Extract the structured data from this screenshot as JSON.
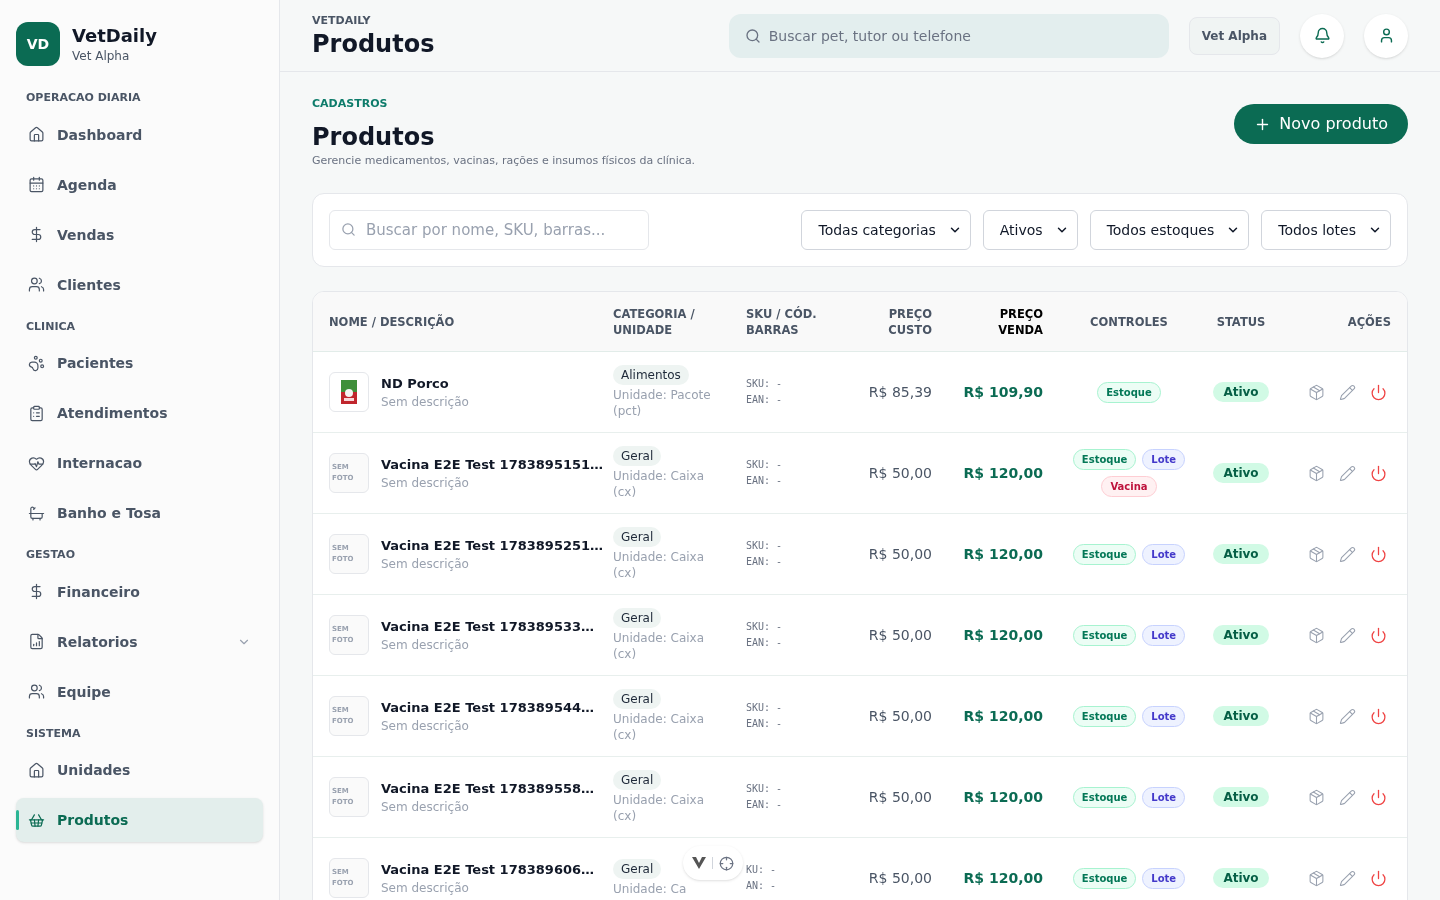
{
  "brand": {
    "logo": "VD",
    "name": "VetDaily",
    "unit": "Vet Alpha"
  },
  "sidebar": [
    {
      "heading": "OPERACAO DIARIA",
      "items": [
        {
          "label": "Dashboard",
          "selected": false
        },
        {
          "label": "Agenda",
          "selected": false
        },
        {
          "label": "Vendas",
          "selected": false
        },
        {
          "label": "Clientes",
          "selected": false
        }
      ]
    },
    {
      "heading": "CLINICA",
      "items": [
        {
          "label": "Pacientes",
          "selected": false
        },
        {
          "label": "Atendimentos",
          "selected": false
        },
        {
          "label": "Internacao",
          "selected": false
        },
        {
          "label": "Banho e Tosa",
          "selected": false
        }
      ]
    },
    {
      "heading": "GESTAO",
      "items": [
        {
          "label": "Financeiro",
          "selected": false
        },
        {
          "label": "Relatorios",
          "selected": false,
          "expanded": false
        },
        {
          "label": "Equipe",
          "selected": false
        }
      ]
    },
    {
      "heading": "SISTEMA",
      "items": [
        {
          "label": "Unidades",
          "selected": false
        },
        {
          "label": "Produtos",
          "selected": true
        }
      ]
    }
  ],
  "topbar": {
    "eyebrow": "VETDAILY",
    "title": "Produtos",
    "search_placeholder": "Buscar pet, tutor ou telefone",
    "unit_button": "Vet Alpha"
  },
  "page": {
    "eyebrow": "CADASTROS",
    "title": "Produtos",
    "subtitle": "Gerencie medicamentos, vacinas, rações e insumos físicos da clínica.",
    "new_button": "Novo produto"
  },
  "filters": {
    "search_placeholder": "Buscar por nome, SKU, barras...",
    "selects": [
      "Todas categorias",
      "Ativos",
      "Todos estoques",
      "Todos lotes"
    ]
  },
  "table": {
    "columns": [
      "NOME / DESCRIÇÃO",
      "CATEGORIA / UNIDADE",
      "SKU / CÓD. BARRAS",
      "PREÇO CUSTO",
      "PREÇO VENDA",
      "CONTROLES",
      "STATUS",
      "AÇÕES"
    ],
    "rows": [
      {
        "photo": {
          "kind": "picture"
        },
        "name": "ND Porco",
        "description": "Sem descrição",
        "category": "Alimentos",
        "unit": "Unidade: Pacote (pct)",
        "sku": "SKU: -",
        "ean": "EAN: -",
        "cost": "R$ 85,39",
        "price": "R$ 109,90",
        "tags": [
          {
            "kind": "estoque",
            "label": "Estoque"
          }
        ],
        "status": "Ativo"
      },
      {
        "photo": {
          "kind": "none",
          "text": "SEM FOTO"
        },
        "name": "Vacina E2E Test 1783895151…",
        "description": "Sem descrição",
        "category": "Geral",
        "unit": "Unidade: Caixa (cx)",
        "sku": "SKU: -",
        "ean": "EAN: -",
        "cost": "R$ 50,00",
        "price": "R$ 120,00",
        "tags": [
          {
            "kind": "estoque",
            "label": "Estoque"
          },
          {
            "kind": "lote",
            "label": "Lote"
          },
          {
            "kind": "vacina",
            "label": "Vacina"
          }
        ],
        "status": "Ativo"
      },
      {
        "photo": {
          "kind": "none",
          "text": "SEM FOTO"
        },
        "name": "Vacina E2E Test 1783895251…",
        "description": "Sem descrição",
        "category": "Geral",
        "unit": "Unidade: Caixa (cx)",
        "sku": "SKU: -",
        "ean": "EAN: -",
        "cost": "R$ 50,00",
        "price": "R$ 120,00",
        "tags": [
          {
            "kind": "estoque",
            "label": "Estoque"
          },
          {
            "kind": "lote",
            "label": "Lote"
          }
        ],
        "status": "Ativo"
      },
      {
        "photo": {
          "kind": "none",
          "text": "SEM FOTO"
        },
        "name": "Vacina E2E Test 178389533…",
        "description": "Sem descrição",
        "category": "Geral",
        "unit": "Unidade: Caixa (cx)",
        "sku": "SKU: -",
        "ean": "EAN: -",
        "cost": "R$ 50,00",
        "price": "R$ 120,00",
        "tags": [
          {
            "kind": "estoque",
            "label": "Estoque"
          },
          {
            "kind": "lote",
            "label": "Lote"
          }
        ],
        "status": "Ativo"
      },
      {
        "photo": {
          "kind": "none",
          "text": "SEM FOTO"
        },
        "name": "Vacina E2E Test 178389544…",
        "description": "Sem descrição",
        "category": "Geral",
        "unit": "Unidade: Caixa (cx)",
        "sku": "SKU: -",
        "ean": "EAN: -",
        "cost": "R$ 50,00",
        "price": "R$ 120,00",
        "tags": [
          {
            "kind": "estoque",
            "label": "Estoque"
          },
          {
            "kind": "lote",
            "label": "Lote"
          }
        ],
        "status": "Ativo"
      },
      {
        "photo": {
          "kind": "none",
          "text": "SEM FOTO"
        },
        "name": "Vacina E2E Test 178389558…",
        "description": "Sem descrição",
        "category": "Geral",
        "unit": "Unidade: Caixa (cx)",
        "sku": "SKU: -",
        "ean": "EAN: -",
        "cost": "R$ 50,00",
        "price": "R$ 120,00",
        "tags": [
          {
            "kind": "estoque",
            "label": "Estoque"
          },
          {
            "kind": "lote",
            "label": "Lote"
          }
        ],
        "status": "Ativo"
      },
      {
        "photo": {
          "kind": "none",
          "text": "SEM FOTO"
        },
        "name": "Vacina E2E Test 178389606…",
        "description": "Sem descrição",
        "category": "Geral",
        "unit": "Unidade: Ca",
        "sku": "KU: -",
        "ean": "AN: -",
        "cost": "R$ 50,00",
        "price": "R$ 120,00",
        "tags": [
          {
            "kind": "estoque",
            "label": "Estoque"
          },
          {
            "kind": "lote",
            "label": "Lote"
          }
        ],
        "status": "Ativo"
      }
    ]
  }
}
